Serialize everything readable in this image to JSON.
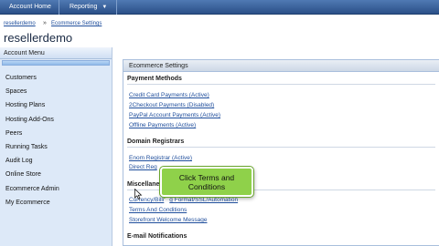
{
  "topnav": {
    "home_label": "Account Home",
    "reporting_label": "Reporting"
  },
  "breadcrumb": {
    "root": "resellerdemo",
    "separator": "»",
    "current": "Ecommerce Settings"
  },
  "page": {
    "title": "resellerdemo"
  },
  "sidebar": {
    "header": "Account Menu",
    "items": [
      {
        "label": "Customers"
      },
      {
        "label": "Spaces"
      },
      {
        "label": "Hosting Plans"
      },
      {
        "label": "Hosting Add-Ons"
      },
      {
        "label": "Peers"
      },
      {
        "label": "Running Tasks"
      },
      {
        "label": "Audit Log"
      },
      {
        "label": "Online Store"
      },
      {
        "label": "Ecommerce Admin"
      },
      {
        "label": "My Ecommerce"
      }
    ]
  },
  "panel": {
    "title": "Ecommerce Settings",
    "payment": {
      "title": "Payment Methods",
      "links": [
        "Credit Card Payments (Active)",
        "2Checkout Payments (Disabled)",
        "PayPal Account Payments (Active)",
        "Offline Payments (Active)"
      ]
    },
    "registrars": {
      "title": "Domain Registrars",
      "links": [
        "Enom Registrar (Active)",
        "Direct Reg"
      ]
    },
    "misc": {
      "title": "Miscellane",
      "links": [
        "Currency/Billi",
        "g Format/SSL/Automation",
        "Terms And Conditions",
        "Storefront Welcome Message"
      ]
    },
    "email": {
      "title": "E-mail Notifications"
    }
  },
  "tooltip": {
    "line1_prefix": "Click ",
    "line1_bold": "Terms and",
    "line2": "Conditions"
  },
  "colors": {
    "accent": "#2b5088",
    "link": "#1f4e9c",
    "tooltip": "#8fd14a",
    "sidebar": "#dde9f8"
  }
}
